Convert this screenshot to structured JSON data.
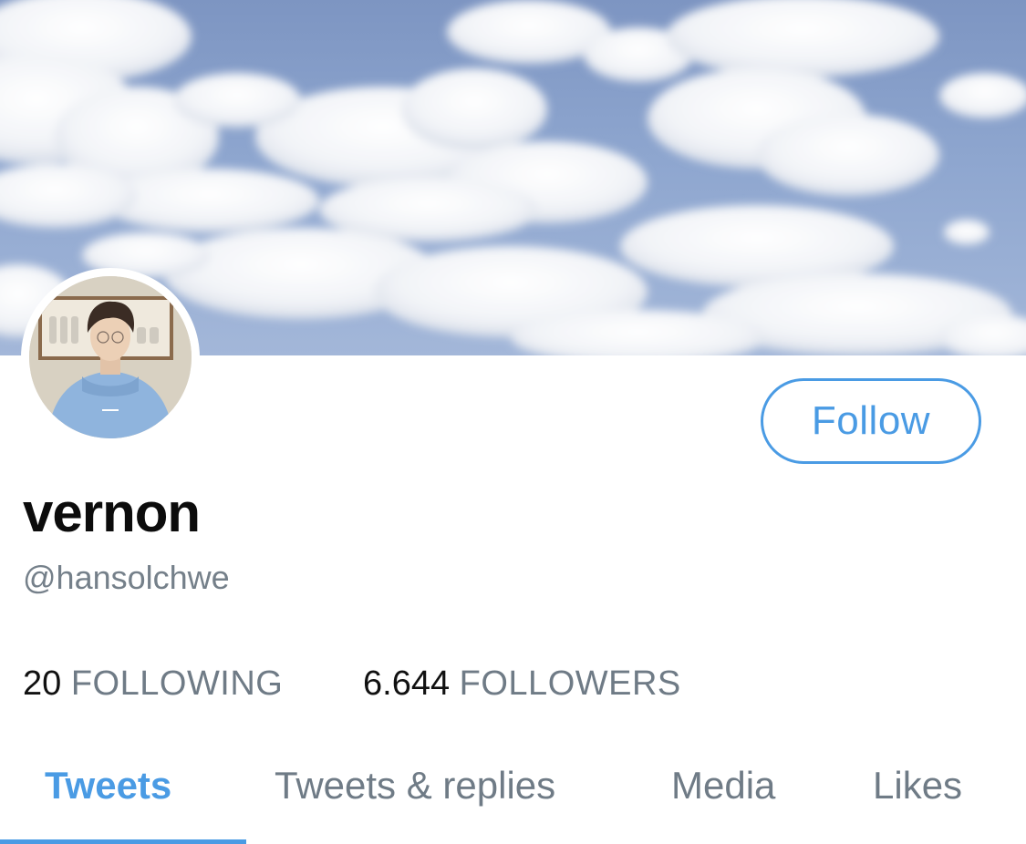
{
  "profile": {
    "display_name": "vernon",
    "handle": "@hansolchwe",
    "follow_label": "Follow"
  },
  "stats": {
    "following_count": "20",
    "following_label": "FOLLOWING",
    "followers_count": "6.644",
    "followers_label": "FOLLOWERS"
  },
  "tabs": [
    {
      "label": "Tweets",
      "active": true
    },
    {
      "label": "Tweets & replies",
      "active": false
    },
    {
      "label": "Media",
      "active": false
    },
    {
      "label": "Likes",
      "active": false
    }
  ],
  "colors": {
    "accent": "#4a9be4",
    "text_primary": "#0c0c0c",
    "text_secondary": "#6f7b86",
    "sky": "#8ea6cf"
  }
}
